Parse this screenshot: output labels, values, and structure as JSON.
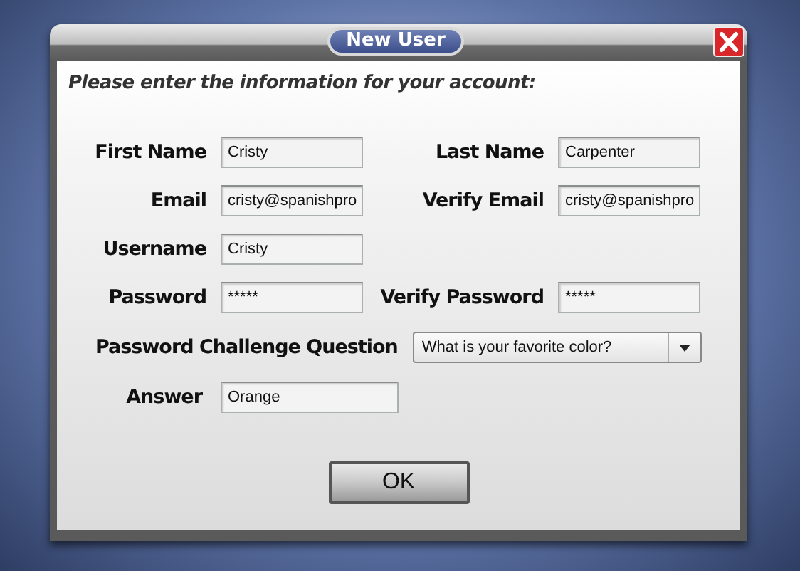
{
  "dialog": {
    "title": "New User",
    "prompt": "Please enter the information for your account:",
    "rows": [
      {
        "fields": [
          {
            "label": "First Name",
            "value": "Cristy"
          },
          {
            "label": "Last Name",
            "value": "Carpenter"
          }
        ]
      },
      {
        "fields": [
          {
            "label": "Email",
            "value": "cristy@spanishpro"
          },
          {
            "label": "Verify Email",
            "value": "cristy@spanishpro"
          }
        ]
      },
      {
        "fields": [
          {
            "label": "Username",
            "value": "Cristy"
          }
        ]
      },
      {
        "fields": [
          {
            "label": "Password",
            "value": "*****"
          },
          {
            "label": "Verify Password",
            "value": "*****"
          }
        ]
      }
    ],
    "challenge": {
      "label": "Password Challenge Question",
      "value": "What is your favorite color?"
    },
    "answer": {
      "label": "Answer",
      "value": "Orange"
    },
    "buttons": [
      "OK"
    ]
  }
}
